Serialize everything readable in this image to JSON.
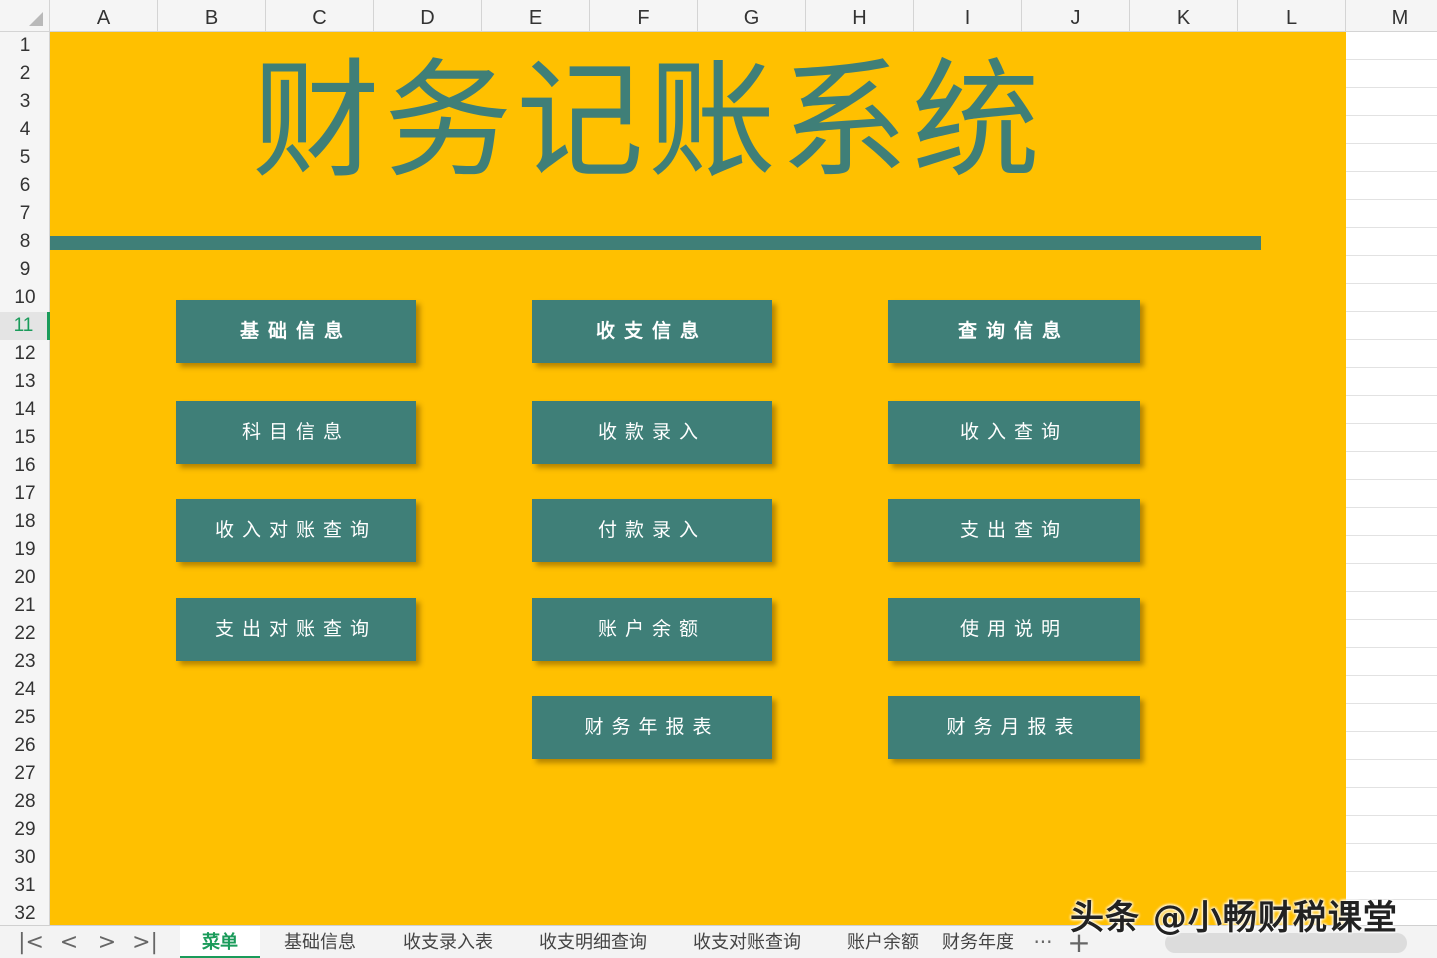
{
  "columns": [
    "A",
    "B",
    "C",
    "D",
    "E",
    "F",
    "G",
    "H",
    "I",
    "J",
    "K",
    "L",
    "M"
  ],
  "rows": [
    "1",
    "2",
    "3",
    "4",
    "5",
    "6",
    "7",
    "8",
    "9",
    "10",
    "11",
    "12",
    "13",
    "14",
    "15",
    "16",
    "17",
    "18",
    "19",
    "20",
    "21",
    "22",
    "23",
    "24",
    "25",
    "26",
    "27",
    "28",
    "29",
    "30",
    "31",
    "32"
  ],
  "active_row": "11",
  "title": "财务记账系统",
  "buttons": {
    "basic_header": "基础信息",
    "income_expense_header": "收支信息",
    "query_header": "查询信息",
    "subject_info": "科目信息",
    "income_reconcile_query": "收入对账查询",
    "expense_reconcile_query": "支出对账查询",
    "receipt_entry": "收款录入",
    "payment_entry": "付款录入",
    "account_balance": "账户余额",
    "annual_report": "财务年报表",
    "income_query": "收入查询",
    "expense_query": "支出查询",
    "usage_guide": "使用说明",
    "monthly_report": "财务月报表"
  },
  "sheet_nav": {
    "first": "|<",
    "prev": "<",
    "next": ">",
    "last": ">|"
  },
  "sheets": [
    "菜单",
    "基础信息",
    "收支录入表",
    "收支明细查询",
    "收支对账查询",
    "账户余额",
    "财务年度"
  ],
  "more_label": "···",
  "add_label": "+",
  "watermark": "头条 @小畅财税课堂",
  "colors": {
    "background": "#ffc000",
    "accent": "#3f7f78",
    "active_tab": "#1a9b5a"
  }
}
